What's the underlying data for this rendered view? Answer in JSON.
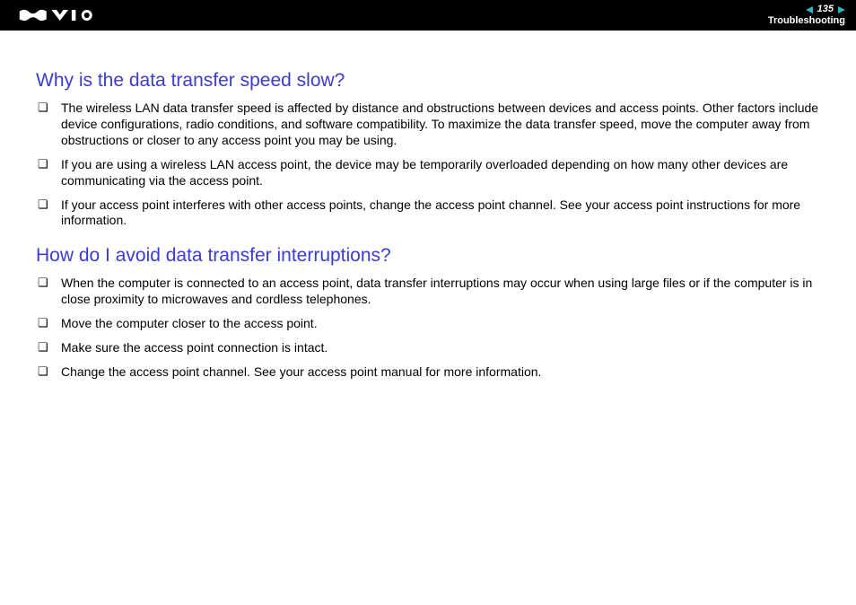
{
  "header": {
    "page_number": "135",
    "section": "Troubleshooting"
  },
  "sections": [
    {
      "heading": "Why is the data transfer speed slow?",
      "items": [
        "The wireless LAN data transfer speed is affected by distance and obstructions between devices and access points. Other factors include device configurations, radio conditions, and software compatibility. To maximize the data transfer speed, move the computer away from obstructions or closer to any access point you may be using.",
        "If you are using a wireless LAN access point, the device may be temporarily overloaded depending on how many other devices are communicating via the access point.",
        "If your access point interferes with other access points, change the access point channel. See your access point instructions for more information."
      ]
    },
    {
      "heading": "How do I avoid data transfer interruptions?",
      "items": [
        "When the computer is connected to an access point, data transfer interruptions may occur when using large files or if the computer is in close proximity to microwaves and cordless telephones.",
        "Move the computer closer to the access point.",
        "Make sure the access point connection is intact.",
        "Change the access point channel. See your access point manual for more information."
      ]
    }
  ]
}
